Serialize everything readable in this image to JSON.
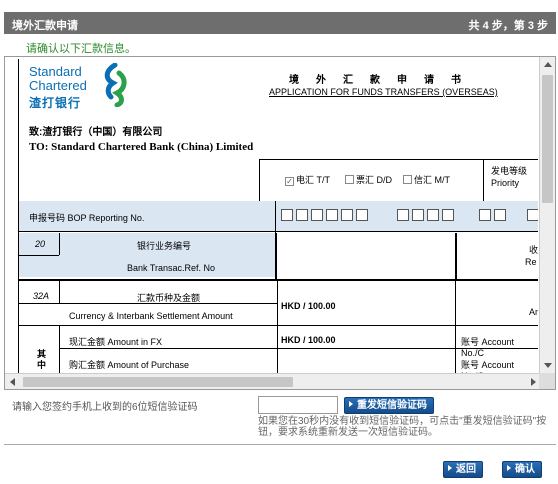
{
  "header": {
    "title": "境外汇款申请",
    "step": "共 4 步，第 3 步"
  },
  "confirm_msg": "请确认以下汇款信息。",
  "form": {
    "logo_en_line1": "Standard",
    "logo_en_line2": "Chartered",
    "logo_cn": "渣打银行",
    "title_cn": "境外汇款申请书",
    "title_en": "APPLICATION FOR FUNDS TRANSFERS (OVERSEAS)",
    "to_cn": "致:渣打银行（中国）有限公司",
    "to_en": "TO: Standard Chartered Bank (China) Limited",
    "methods": [
      {
        "label": "电汇 T/T",
        "checked": true
      },
      {
        "label": "票汇 D/D",
        "checked": false
      },
      {
        "label": "信汇 M/T",
        "checked": false
      }
    ],
    "priority_cn": "发电等级",
    "priority_en": "Priority",
    "bop_label": "申报号码 BOP Reporting No.",
    "ref_num": "20",
    "ref_cn": "银行业务编号",
    "ref_en": "Bank Transac.Ref. No",
    "ref_right_cn": "收",
    "ref_right_en": "Re",
    "cur_num": "32A",
    "cur_cn": "汇款币种及金额",
    "cur_en": "Currency & Interbank Settlement Amount",
    "cur_value": "HKD / 100.00",
    "cur_right": "Am",
    "fx_label": "现汇金额 Amount in FX",
    "fx_value": "HKD / 100.00",
    "fx_acct": "账号 Account No./C",
    "pur_label": "购汇金额 Amount of Purchase",
    "pur_acct": "账号 Account No./C",
    "side_cn": "其中"
  },
  "sms": {
    "label": "请输入您签约手机上收到的6位短信验证码",
    "input_value": "",
    "resend_label": "重发短信验证码",
    "note": "如果您在30秒内没有收到短信验证码，可点击\"重发短信验证码\"按钮，要求系统重新发送一次短信验证码。"
  },
  "buttons": {
    "back": "返回",
    "confirm": "确认"
  }
}
